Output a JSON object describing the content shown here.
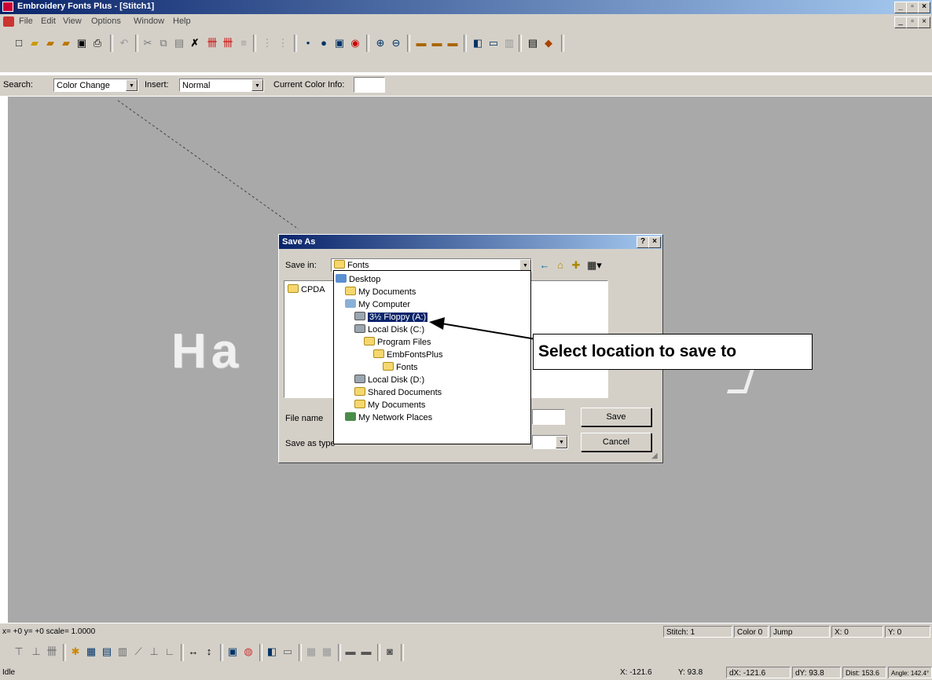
{
  "app": {
    "title": "Embroidery Fonts Plus - [Stitch1]"
  },
  "menu": [
    "File",
    "Edit",
    "View",
    "Options",
    "Window",
    "Help"
  ],
  "searchbar": {
    "search_label": "Search:",
    "search_value": "Color Change",
    "insert_label": "Insert:",
    "insert_value": "Normal",
    "current_color_label": "Current Color Info:"
  },
  "canvas": {
    "preview_text": "Ha"
  },
  "dialog": {
    "title": "Save As",
    "help_glyph": "?",
    "close_glyph": "×",
    "save_in_label": "Save in:",
    "save_in_value": "Fonts",
    "list_item": "CPDA",
    "file_name_label": "File name",
    "save_as_type_label": "Save as type",
    "save_button": "Save",
    "cancel_button": "Cancel"
  },
  "dropdown": [
    "Desktop",
    "My Documents",
    "My Computer",
    "3½ Floppy (A:)",
    "Local Disk (C:)",
    "Program Files",
    "EmbFontsPlus",
    "Fonts",
    "Local Disk (D:)",
    "Shared Documents",
    "My Documents",
    "My Network Places"
  ],
  "callout": {
    "text": "Select location to save to"
  },
  "status1": {
    "coords": "x= +0 y= +0 scale= 1.0000",
    "stitch": "Stitch: 1",
    "color": "Color 0",
    "jump": "Jump",
    "x": "X: 0",
    "y": "Y: 0"
  },
  "status2": {
    "state": "Idle",
    "x": "X: -121.6",
    "y": "Y: 93.8",
    "dx": "dX: -121.6",
    "dy": "dY: 93.8",
    "dist": "Dist: 153.6",
    "angle": "Angle: 142.4°"
  }
}
